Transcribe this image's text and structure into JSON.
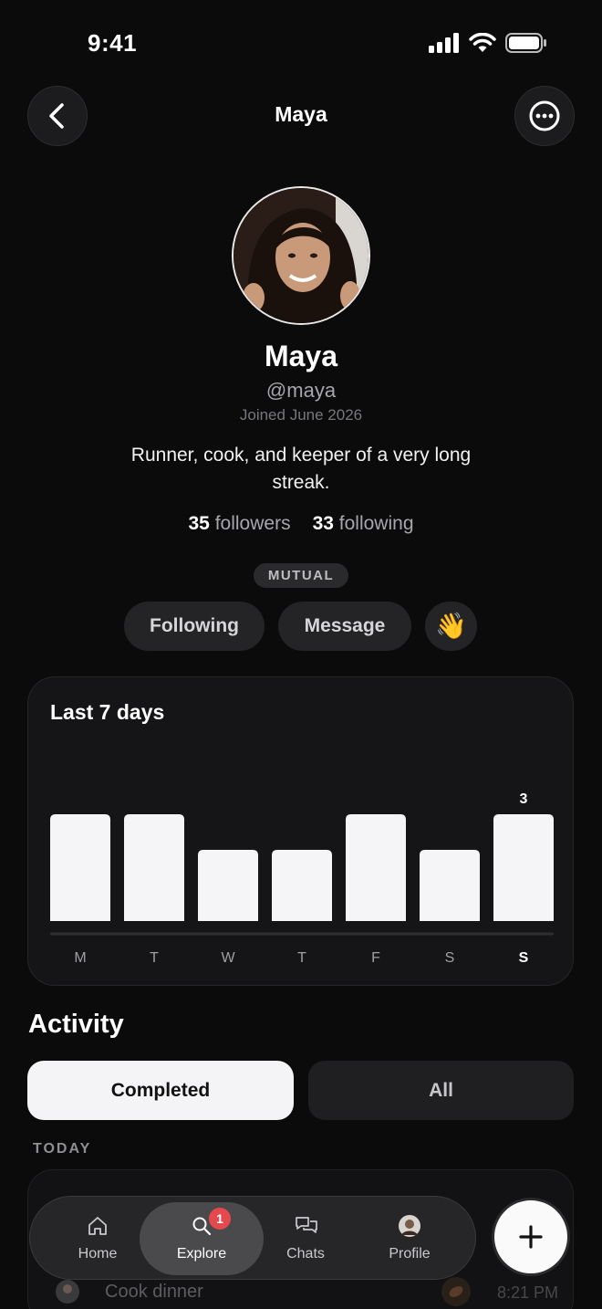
{
  "status_bar": {
    "time": "9:41"
  },
  "header": {
    "title": "Maya"
  },
  "profile": {
    "name": "Maya",
    "handle": "@maya",
    "joined": "Joined June 2026",
    "bio": "Runner, cook, and keeper of a very long streak.",
    "followers_count": "35",
    "followers_label": "followers",
    "following_count": "33",
    "following_label": "following",
    "mutual_badge": "MUTUAL",
    "following_button": "Following",
    "message_button": "Message",
    "wave_button": "👋"
  },
  "chart_data": {
    "type": "bar",
    "title": "Last 7 days",
    "categories": [
      "M",
      "T",
      "W",
      "T",
      "F",
      "S",
      "S"
    ],
    "values": [
      3,
      3,
      2,
      2,
      3,
      2,
      3
    ],
    "highlight_label": "3",
    "highlight_index": 6,
    "ylim": [
      0,
      3
    ],
    "bar_color": "#f5f5f7"
  },
  "activity": {
    "title": "Activity",
    "tabs": [
      {
        "label": "Completed",
        "active": true
      },
      {
        "label": "All",
        "active": false
      }
    ],
    "section_label": "TODAY",
    "items": [
      {
        "label": "Cook dinner",
        "time": "8:21 PM"
      }
    ]
  },
  "tab_bar": {
    "tabs": [
      {
        "label": "Home",
        "icon": "home-icon"
      },
      {
        "label": "Explore",
        "icon": "search-icon",
        "badge": "1",
        "active": true
      },
      {
        "label": "Chats",
        "icon": "chat-bubbles-icon"
      },
      {
        "label": "Profile",
        "icon": "avatar-icon"
      }
    ],
    "fab_icon": "plus-icon"
  }
}
